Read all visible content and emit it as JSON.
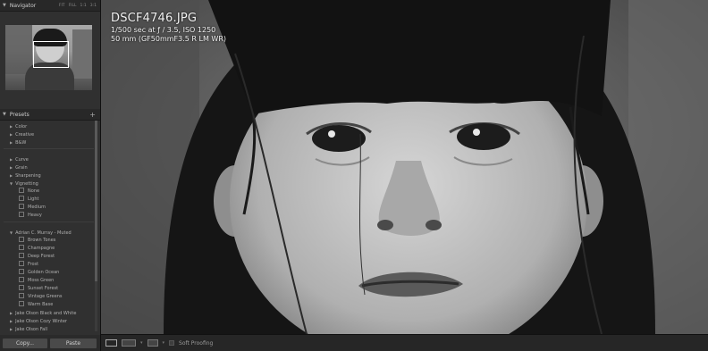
{
  "navigator": {
    "title": "Navigator",
    "zoom_options": [
      "FIT",
      "FILL",
      "1:1",
      "3:1"
    ]
  },
  "presets": {
    "title": "Presets",
    "add_label": "+",
    "groups_top": [
      "Color",
      "Creative",
      "B&W"
    ],
    "groups_mid": [
      "Curve",
      "Grain",
      "Sharpening"
    ],
    "vignetting": {
      "label": "Vignetting",
      "items": [
        "None",
        "Light",
        "Medium",
        "Heavy"
      ]
    },
    "user_folder": {
      "label": "Adrian C. Murray - Muted",
      "items": [
        "Brown Tones",
        "Champagne",
        "Deep Forest",
        "Frost",
        "Golden Ocean",
        "Moss Green",
        "Sunset Forest",
        "Vintage Greens",
        "Warm Base"
      ]
    },
    "extra_folders": [
      "Jake Olson Black and White",
      "Jake Olson Cozy Winter",
      "Jake Olson Fall"
    ]
  },
  "buttons": {
    "copy": "Copy...",
    "paste": "Paste"
  },
  "image_info": {
    "filename": "DSCF4746.JPG",
    "exposure": "1/500 sec at ƒ / 3.5, ISO 1250",
    "lens": "50 mm (GF50mmF3.5 R LM WR)"
  },
  "toolbar": {
    "soft_proofing": "Soft Proofing"
  }
}
